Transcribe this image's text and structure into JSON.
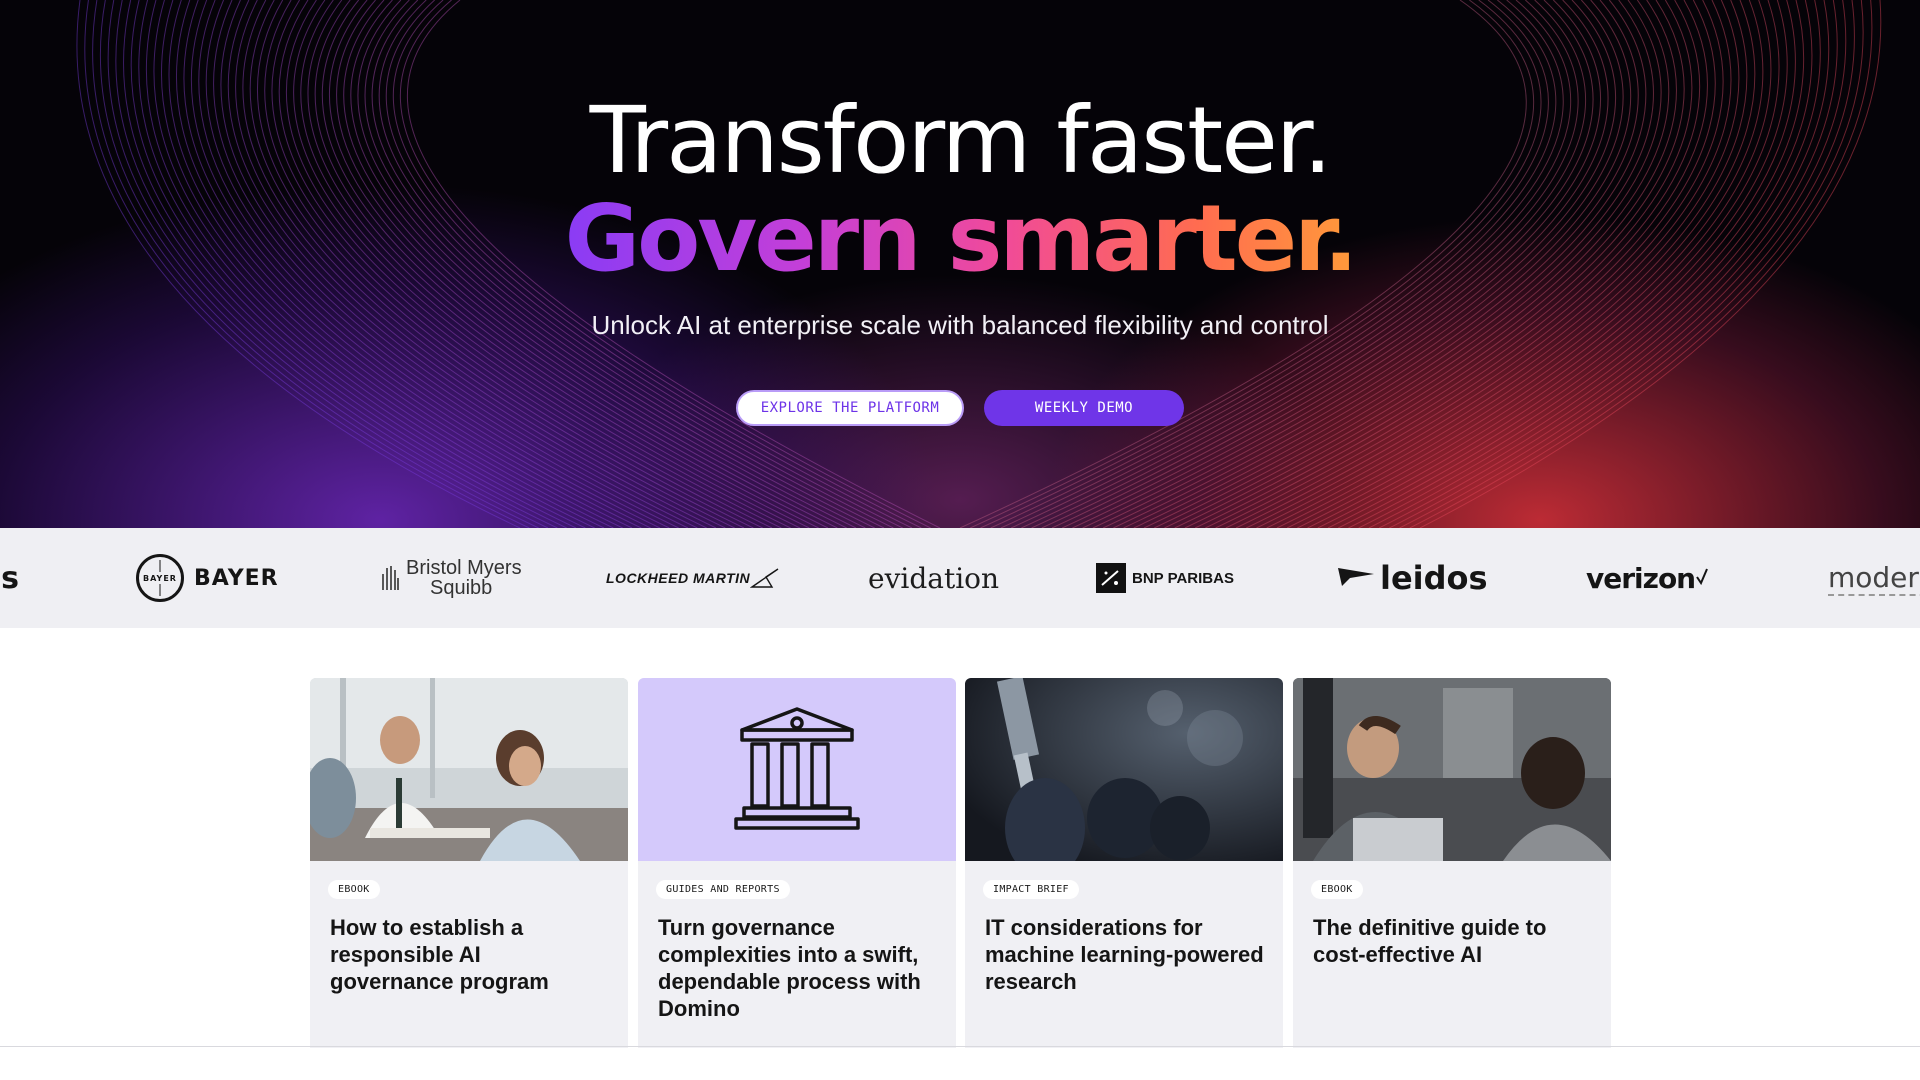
{
  "hero": {
    "title_line1": "Transform faster.",
    "title_line2": "Govern smarter.",
    "subtitle": "Unlock AI at enterprise scale with balanced flexibility and control",
    "buttons": {
      "explore": "EXPLORE THE PLATFORM",
      "demo": "WEEKLY DEMO"
    }
  },
  "logos": {
    "partial_left": "'s",
    "bayer": "BAYER",
    "bayer_mark": "BAYER",
    "bms_line1": "Bristol Myers",
    "bms_line2": "Squibb",
    "lockheed": "LOCKHEED MARTIN",
    "evidation": "evidation",
    "bnp": "BNP PARIBAS",
    "leidos": "leidos",
    "verizon": "verizon",
    "modern_partial": "modern"
  },
  "cards": [
    {
      "tag": "EBOOK",
      "title": "How to establish a responsible AI governance program",
      "image": "meeting-photo"
    },
    {
      "tag": "GUIDES AND REPORTS",
      "title": "Turn governance complexities into a swift, dependable process with Domino",
      "image": "bank-icon"
    },
    {
      "tag": "IMPACT BRIEF",
      "title": "IT considerations for machine learning-powered research",
      "image": "lab-vial-photo"
    },
    {
      "tag": "EBOOK",
      "title": "The definitive guide to cost-effective AI",
      "image": "office-conversation-photo"
    }
  ],
  "colors": {
    "accent_purple": "#6f35e8",
    "gradient_start": "#8a3cf5",
    "gradient_end": "#ff9a3a",
    "card_bg": "#f0f0f4",
    "bank_tile_bg": "#d4c9fb"
  }
}
